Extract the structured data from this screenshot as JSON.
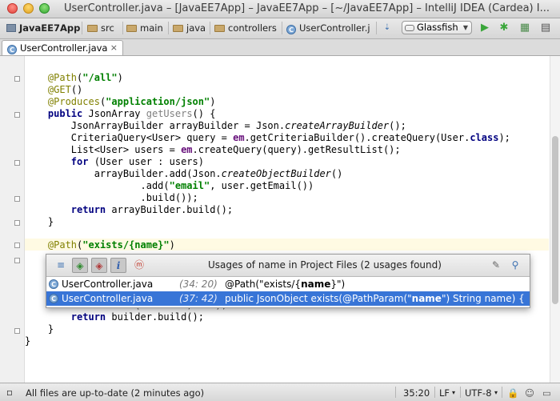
{
  "window": {
    "title": "UserController.java – [JavaEE7App] – JavaEE7App] – [~/JavaEE7App] – IntelliJ IDEA (Cardea) I..."
  },
  "navbar": {
    "breadcrumbs": [
      "JavaEE7App",
      "src",
      "main",
      "java",
      "controllers",
      "UserController.j"
    ],
    "run_config": "Glassfish",
    "tool_icons": [
      "vcs-update-icon",
      "run-icon",
      "debug-icon",
      "coverage-icon"
    ]
  },
  "tabs": [
    {
      "label": "UserController.java",
      "close": "×"
    }
  ],
  "editor": {
    "lines": [
      "    @Path(\"/all\")",
      "    @GET()",
      "    @Produces(\"application/json\")",
      "    public JsonArray getUsers() {",
      "        JsonArrayBuilder arrayBuilder = Json.createArrayBuilder();",
      "        CriteriaQuery<User> query = em.getCriteriaBuilder().createQuery(User.class);",
      "        List<User> users = em.createQuery(query).getResultList();",
      "        for (User user : users)",
      "            arrayBuilder.add(Json.createObjectBuilder()",
      "                    .add(\"email\", user.getEmail())",
      "                    .build());",
      "        return arrayBuilder.build();",
      "    }",
      "",
      "    @Path(\"exists/{name}\")",
      "",
      "",
      "",
      "        builder.add(\"exists\", ...);",
      "        return builder.build();",
      "    }",
      "}"
    ]
  },
  "usages_popup": {
    "title": "Usages of name in Project Files (2 usages found)",
    "rows": [
      {
        "file": "UserController.java",
        "location": "(34: 20)",
        "snippet_before": "@Path(\"exists/{",
        "snippet_match": "name",
        "snippet_after": "}\")"
      },
      {
        "file": "UserController.java",
        "location": "(37: 42)",
        "snippet_before": "public JsonObject exists(@PathParam(\"",
        "snippet_match": "name",
        "snippet_after": "\") String name) {"
      }
    ]
  },
  "statusbar": {
    "message": "All files are up-to-date (2 minutes ago)",
    "position": "35:20",
    "line_separator": "LF",
    "encoding": "UTF-8"
  }
}
